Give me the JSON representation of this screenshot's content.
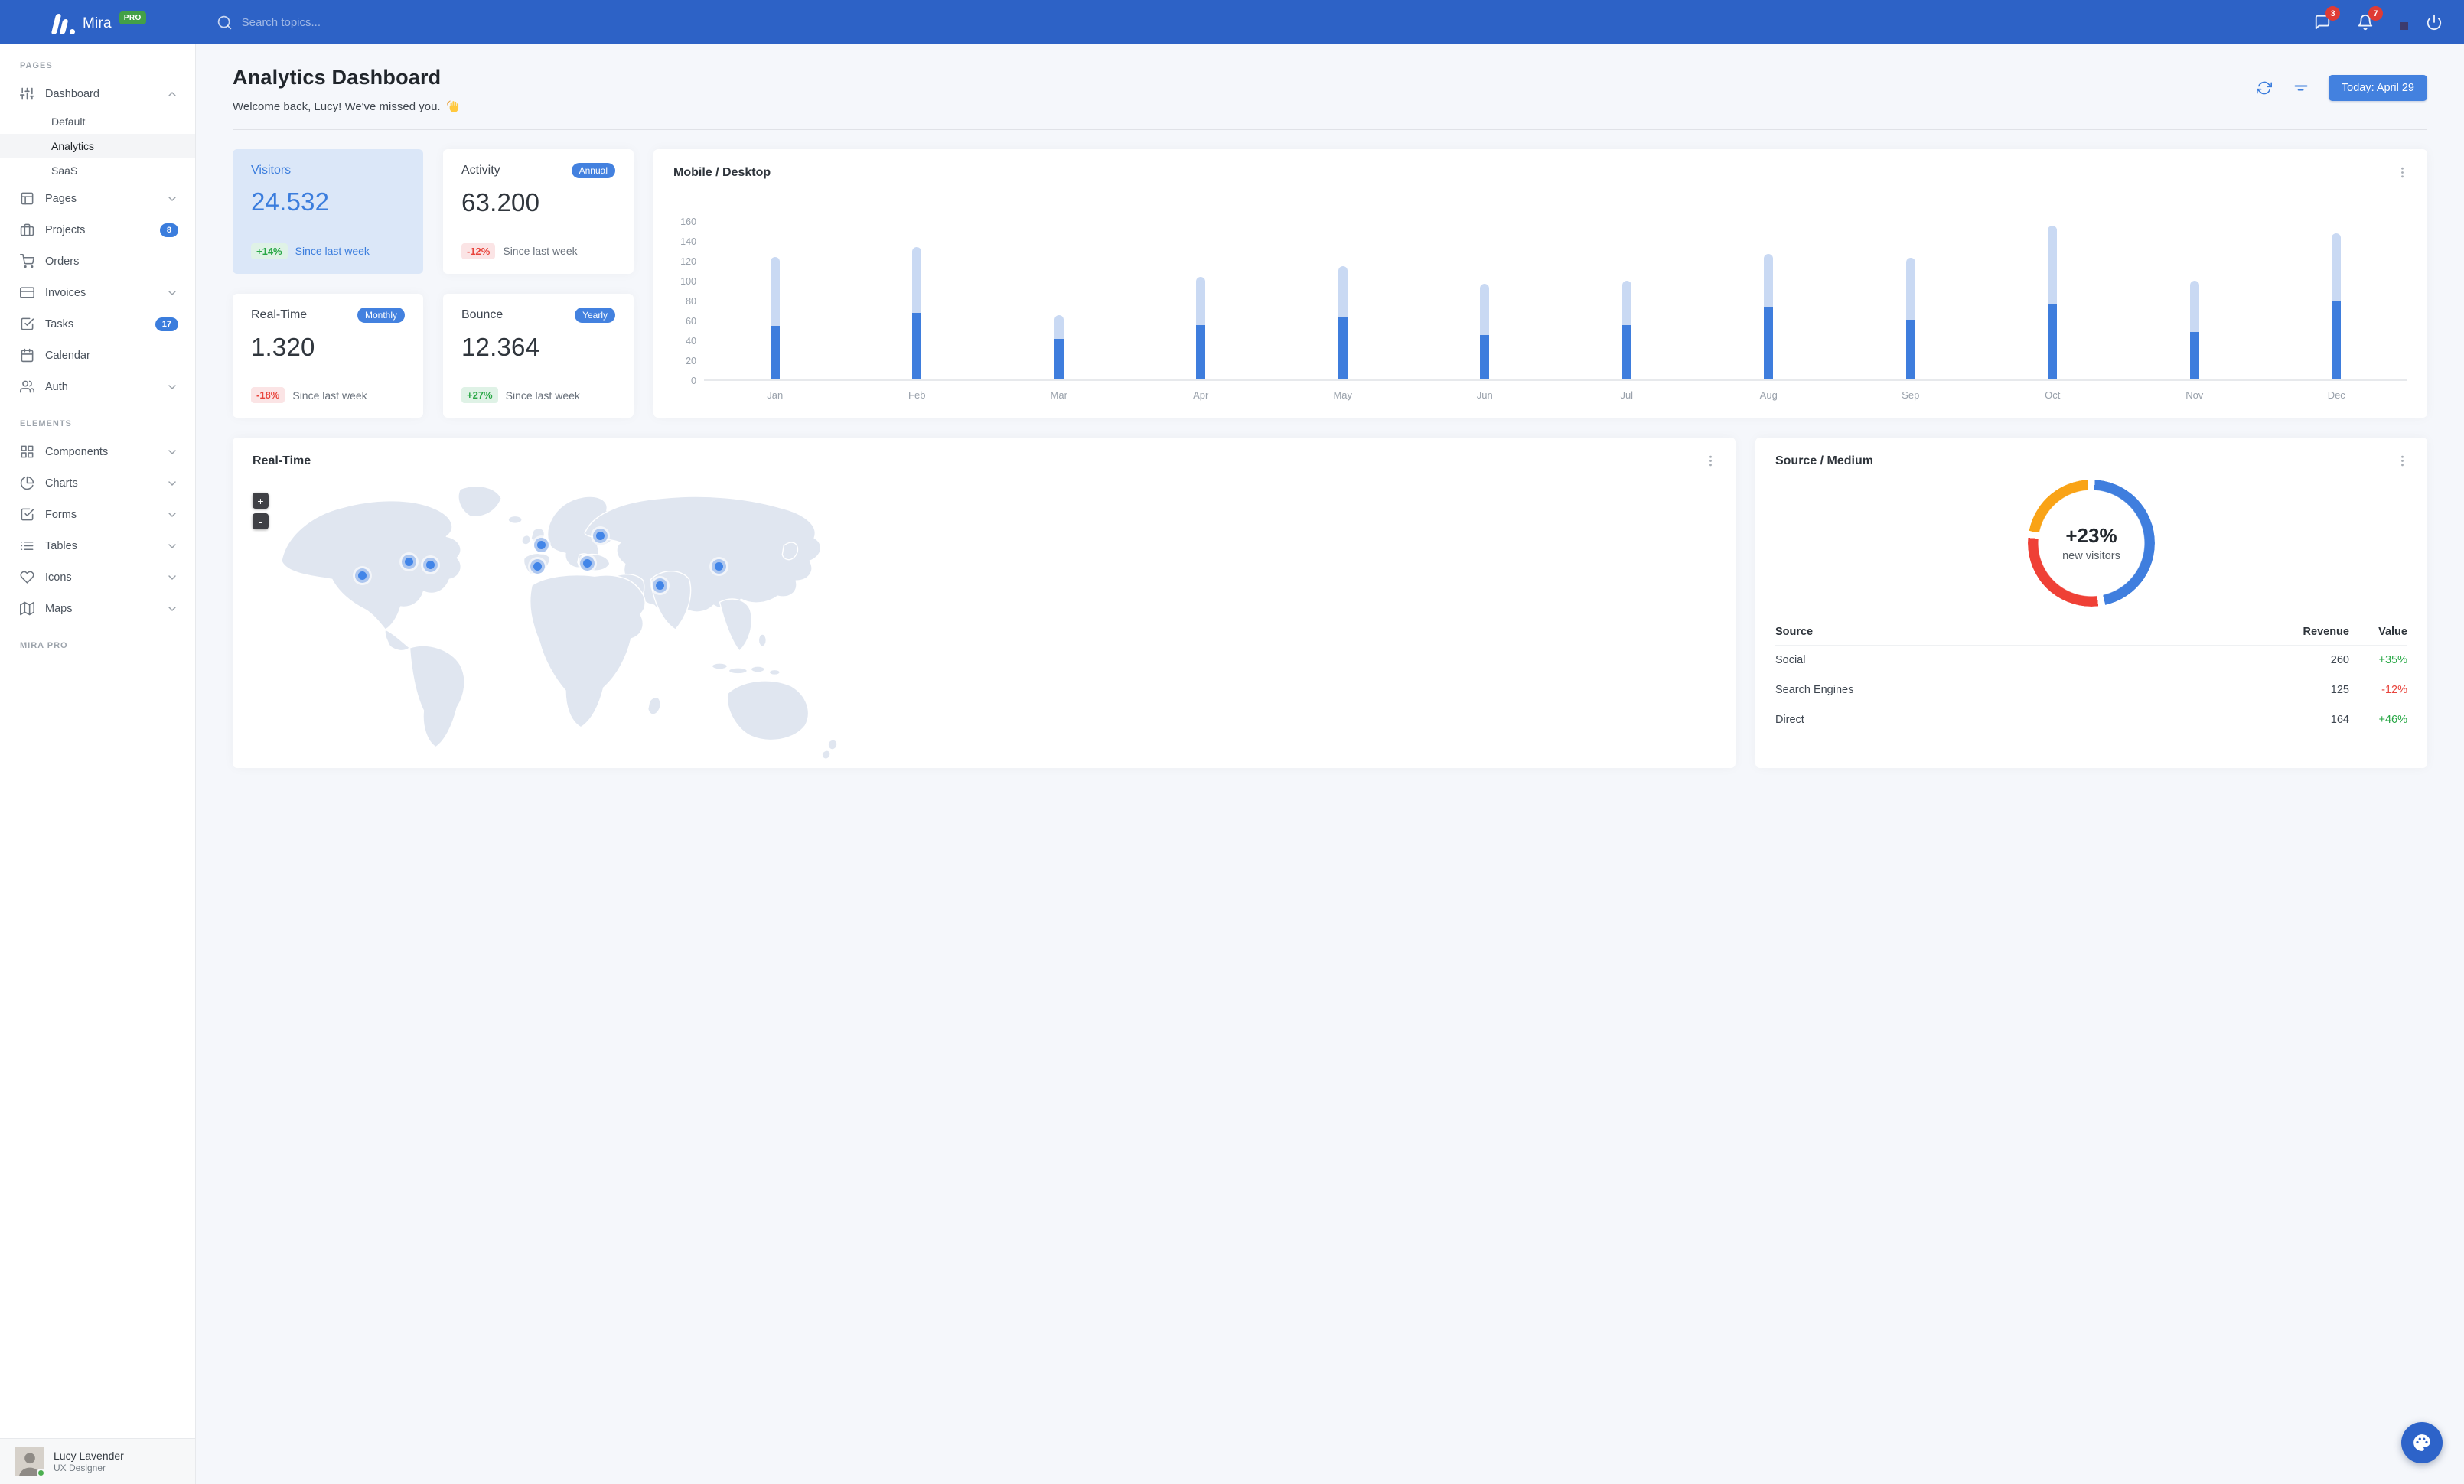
{
  "navbar": {
    "brand": "Mira",
    "brand_badge": "PRO",
    "search_placeholder": "Search topics...",
    "messages_badge": "3",
    "notifications_badge": "7"
  },
  "sidebar": {
    "sections": [
      {
        "label": "Pages",
        "items": [
          {
            "icon": "sliders-icon",
            "label": "Dashboard",
            "chevron": "up",
            "children": [
              {
                "label": "Default",
                "active": false
              },
              {
                "label": "Analytics",
                "active": true
              },
              {
                "label": "SaaS",
                "active": false
              }
            ]
          },
          {
            "icon": "layout-icon",
            "label": "Pages",
            "chevron": "down"
          },
          {
            "icon": "briefcase-icon",
            "label": "Projects",
            "badge": "8"
          },
          {
            "icon": "shopping-cart-icon",
            "label": "Orders"
          },
          {
            "icon": "credit-card-icon",
            "label": "Invoices",
            "chevron": "down"
          },
          {
            "icon": "check-square-icon",
            "label": "Tasks",
            "badge": "17"
          },
          {
            "icon": "calendar-icon",
            "label": "Calendar"
          },
          {
            "icon": "users-icon",
            "label": "Auth",
            "chevron": "down"
          }
        ]
      },
      {
        "label": "Elements",
        "items": [
          {
            "icon": "grid-icon",
            "label": "Components",
            "chevron": "down"
          },
          {
            "icon": "pie-chart-icon",
            "label": "Charts",
            "chevron": "down"
          },
          {
            "icon": "check-square-icon",
            "label": "Forms",
            "chevron": "down"
          },
          {
            "icon": "list-icon",
            "label": "Tables",
            "chevron": "down"
          },
          {
            "icon": "heart-icon",
            "label": "Icons",
            "chevron": "down"
          },
          {
            "icon": "map-icon",
            "label": "Maps",
            "chevron": "down"
          }
        ]
      },
      {
        "label": "Mira Pro",
        "items": []
      }
    ],
    "user": {
      "name": "Lucy Lavender",
      "role": "UX Designer"
    }
  },
  "header": {
    "title": "Analytics Dashboard",
    "subtitle": "Welcome back, Lucy! We've missed you.",
    "subtitle_emoji": "👋",
    "date_button": "Today: April 29"
  },
  "stats": [
    {
      "title": "Visitors",
      "value": "24.532",
      "delta": "+14%",
      "delta_type": "positive",
      "caption": "Since last week",
      "variant": "primary"
    },
    {
      "title": "Activity",
      "value": "63.200",
      "delta": "-12%",
      "delta_type": "negative",
      "caption": "Since last week",
      "pill": "Annual"
    },
    {
      "title": "Real-Time",
      "value": "1.320",
      "delta": "-18%",
      "delta_type": "negative",
      "caption": "Since last week",
      "pill": "Monthly"
    },
    {
      "title": "Bounce",
      "value": "12.364",
      "delta": "+27%",
      "delta_type": "positive",
      "caption": "Since last week",
      "pill": "Yearly"
    }
  ],
  "chart_data": [
    {
      "type": "bar",
      "stacked": true,
      "title": "Mobile / Desktop",
      "categories": [
        "Jan",
        "Feb",
        "Mar",
        "Apr",
        "May",
        "Jun",
        "Jul",
        "Aug",
        "Sep",
        "Oct",
        "Nov",
        "Dec"
      ],
      "series": [
        {
          "name": "Mobile",
          "color": "#3E7DDD",
          "values": [
            54,
            67,
            41,
            55,
            62,
            45,
            55,
            73,
            60,
            76,
            48,
            79
          ]
        },
        {
          "name": "Desktop",
          "color": "#C9D9F3",
          "values": [
            69,
            66,
            24,
            48,
            52,
            51,
            44,
            53,
            62,
            79,
            51,
            68
          ]
        }
      ],
      "xlabel": "",
      "ylabel": "",
      "ylim": [
        0,
        160
      ],
      "yticks": [
        0,
        20,
        40,
        60,
        80,
        100,
        120,
        140,
        160
      ],
      "grid": false,
      "legend": false
    },
    {
      "type": "donut",
      "title": "Source / Medium",
      "center": {
        "value": "+23%",
        "label": "new visitors"
      },
      "slices": [
        {
          "label": "Social",
          "value": 260,
          "color": "#3F7EDE"
        },
        {
          "label": "Direct",
          "value": 164,
          "color": "#EF4036"
        },
        {
          "label": "Search Engines",
          "value": 125,
          "color": "#F9A316"
        }
      ]
    }
  ],
  "realtime_map": {
    "title": "Real-Time",
    "zoom_in_label": "+",
    "zoom_out_label": "-",
    "markers": [
      {
        "x": 143,
        "y": 127
      },
      {
        "x": 204,
        "y": 109
      },
      {
        "x": 232,
        "y": 113
      },
      {
        "x": 377,
        "y": 87
      },
      {
        "x": 372,
        "y": 115
      },
      {
        "x": 437,
        "y": 111
      },
      {
        "x": 454,
        "y": 75
      },
      {
        "x": 532,
        "y": 140
      },
      {
        "x": 609,
        "y": 115
      }
    ]
  },
  "source_medium": {
    "title": "Source / Medium",
    "center_value": "+23%",
    "center_label": "new visitors",
    "table": {
      "headers": [
        "Source",
        "Revenue",
        "Value"
      ],
      "rows": [
        {
          "source": "Social",
          "revenue": "260",
          "value": "+35%",
          "trend": "up"
        },
        {
          "source": "Search Engines",
          "revenue": "125",
          "value": "-12%",
          "trend": "down"
        },
        {
          "source": "Direct",
          "revenue": "164",
          "value": "+46%",
          "trend": "up"
        }
      ]
    }
  }
}
